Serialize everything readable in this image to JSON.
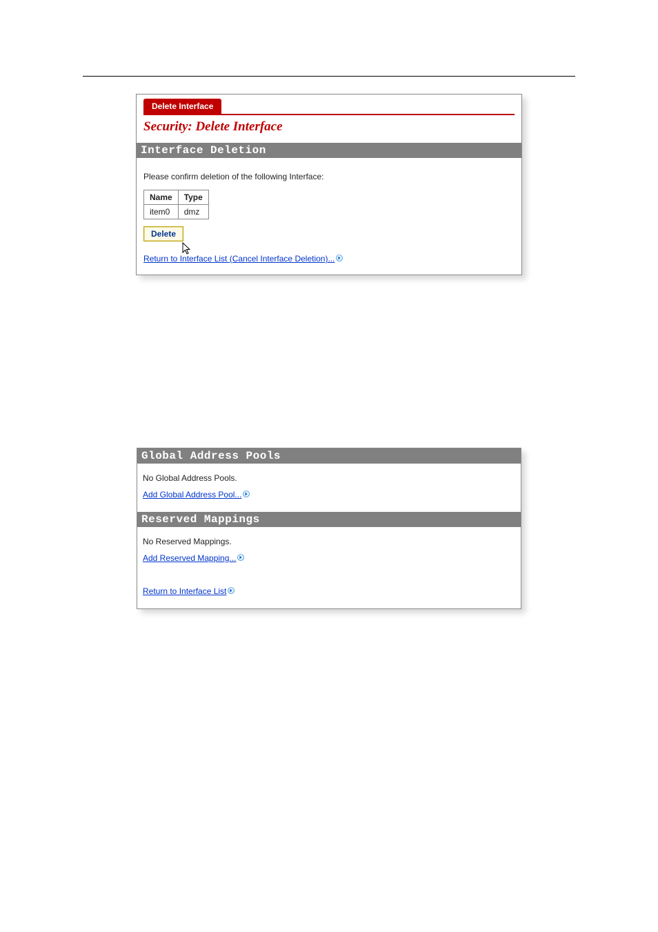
{
  "figure1": {
    "tab_label": "Delete Interface",
    "title": "Security: Delete Interface",
    "section_heading": "Interface Deletion",
    "confirm_text": "Please confirm deletion of the following Interface:",
    "table": {
      "headers": {
        "name": "Name",
        "type": "Type"
      },
      "row": {
        "name": "item0",
        "type": "dmz"
      }
    },
    "delete_button": "Delete",
    "return_link": "Return to Interface List (Cancel Interface Deletion)..."
  },
  "figure2": {
    "section1_heading": "Global Address Pools",
    "section1_empty": "No Global Address Pools.",
    "section1_link": "Add Global Address Pool...",
    "section2_heading": "Reserved Mappings",
    "section2_empty": "No Reserved Mappings.",
    "section2_link": "Add Reserved Mapping...",
    "return_link": "Return to Interface List"
  }
}
